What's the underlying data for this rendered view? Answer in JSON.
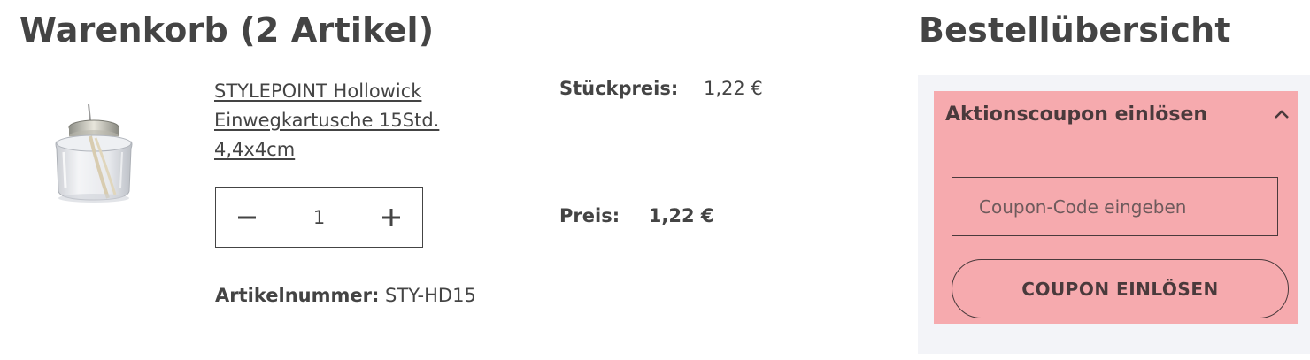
{
  "cart": {
    "title": "Warenkorb (2 Artikel)"
  },
  "product": {
    "name_lines": [
      "STYLEPOINT Hollowick",
      "Einwegkartusche 15Std.",
      "4,4x4cm"
    ],
    "image_icon": "candle-cartridge-icon",
    "quantity": "1",
    "article_number_label": "Artikelnummer:",
    "article_number": "STY-HD15",
    "unit_price_label": "Stückpreis:",
    "unit_price": "1,22 €",
    "price_label": "Preis:",
    "price": "1,22 €"
  },
  "summary": {
    "title": "Bestellübersicht",
    "coupon": {
      "title": "Aktionscoupon einlösen",
      "input_placeholder": "Coupon-Code eingeben",
      "input_value": "",
      "button_label": "COUPON EINLÖSEN"
    }
  },
  "colors": {
    "text": "#444444",
    "coupon_bg": "#f6aaae",
    "panel_bg": "#f3f4f8"
  }
}
